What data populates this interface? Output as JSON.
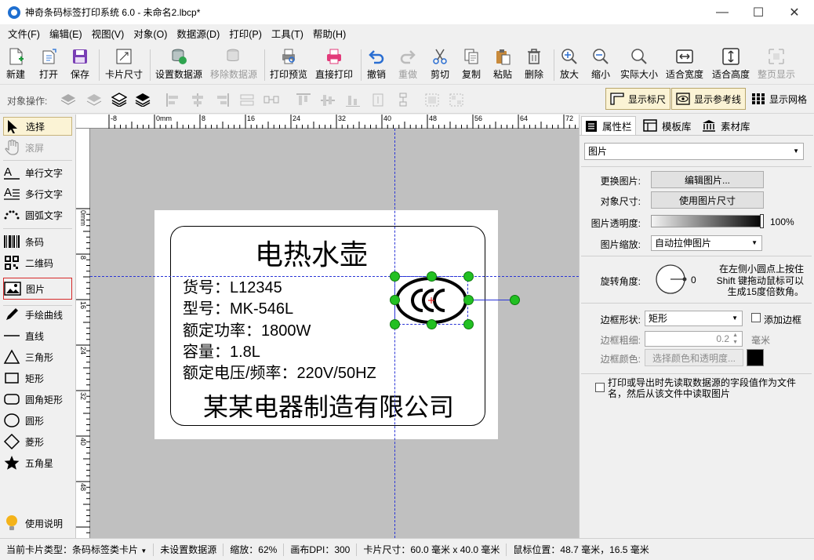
{
  "window": {
    "title": "神奇条码标签打印系统 6.0 - 未命名2.lbcp*",
    "minimize": "—",
    "maximize": "☐",
    "close": "✕"
  },
  "menu": [
    "文件(F)",
    "编辑(E)",
    "视图(V)",
    "对象(O)",
    "数据源(D)",
    "打印(P)",
    "工具(T)",
    "帮助(H)"
  ],
  "toolbar": {
    "new": "新建",
    "open": "打开",
    "save": "保存",
    "card_size": "卡片尺寸",
    "set_datasource": "设置数据源",
    "remove_datasource": "移除数据源",
    "print_preview": "打印预览",
    "direct_print": "直接打印",
    "undo": "撤销",
    "redo": "重做",
    "cut": "剪切",
    "copy": "复制",
    "paste": "粘贴",
    "delete": "删除",
    "zoom_in": "放大",
    "zoom_out": "缩小",
    "actual_size": "实际大小",
    "fit_width": "适合宽度",
    "fit_height": "适合高度",
    "whole_page": "整页显示"
  },
  "objbar": {
    "label": "对象操作:",
    "show_ruler": "显示标尺",
    "show_guides": "显示参考线",
    "show_grid": "显示网格"
  },
  "left_tools": {
    "select": "选择",
    "scroll": "滚屏",
    "single_text": "单行文字",
    "multi_text": "多行文字",
    "arc_text": "圆弧文字",
    "barcode": "条码",
    "qrcode": "二维码",
    "image": "图片",
    "freehand": "手绘曲线",
    "line": "直线",
    "triangle": "三角形",
    "rectangle": "矩形",
    "rounded_rect": "圆角矩形",
    "circle": "圆形",
    "diamond": "菱形",
    "star": "五角星",
    "help": "使用说明"
  },
  "ruler": {
    "h_labels": [
      "-8",
      "0mm",
      "8",
      "16",
      "24",
      "32",
      "40",
      "48",
      "56",
      "64",
      "72"
    ],
    "v_labels": [
      "0mm",
      "8",
      "16",
      "24",
      "32",
      "40",
      "48"
    ]
  },
  "label": {
    "title": "电热水壶",
    "lines": [
      "货号：L12345",
      "型号：MK-546L",
      "额定功率：1800W",
      "容量：1.8L",
      "额定电压/频率：220V/50HZ"
    ],
    "company": "某某电器制造有限公司",
    "cert_mark": "CCC"
  },
  "props": {
    "tabs": [
      "属性栏",
      "模板库",
      "素材库"
    ],
    "object_type": "图片",
    "change_image_label": "更换图片:",
    "edit_image_btn": "编辑图片...",
    "object_size_label": "对象尺寸:",
    "use_image_size_btn": "使用图片尺寸",
    "opacity_label": "图片透明度:",
    "opacity_value": "100%",
    "opacity_fraction": 1.0,
    "scale_label": "图片缩放:",
    "scale_value": "自动拉伸图片",
    "rotation_label": "旋转角度:",
    "rotation_value": "0",
    "rotation_hint": "在左侧小圆点上按住Shift 键拖动鼠标可以生成15度倍数角。",
    "border_shape_label": "边框形状:",
    "border_shape_value": "矩形",
    "add_border": "添加边框",
    "border_width_label": "边框粗细:",
    "border_width_value": "0.2",
    "border_width_unit": "毫米",
    "border_color_label": "边框颜色:",
    "border_color_btn": "选择颜色和透明度...",
    "border_color": "#000000",
    "datasource_note": "打印或导出时先读取数据源的字段值作为文件名，然后从该文件中读取图片"
  },
  "status": {
    "card_type": "当前卡片类型：条码标签类卡片",
    "datasource": "未设置数据源",
    "zoom": "缩放：62%",
    "dpi": "画布DPI：300",
    "card_size": "卡片尺寸：60.0 毫米 x 40.0 毫米",
    "mouse": "鼠标位置：48.7 毫米，16.5 毫米"
  },
  "colors": {
    "accent": "#1f6fd0",
    "guide": "#2a35d6",
    "handle": "#22c022",
    "selection_bg": "#fbf3d5"
  }
}
